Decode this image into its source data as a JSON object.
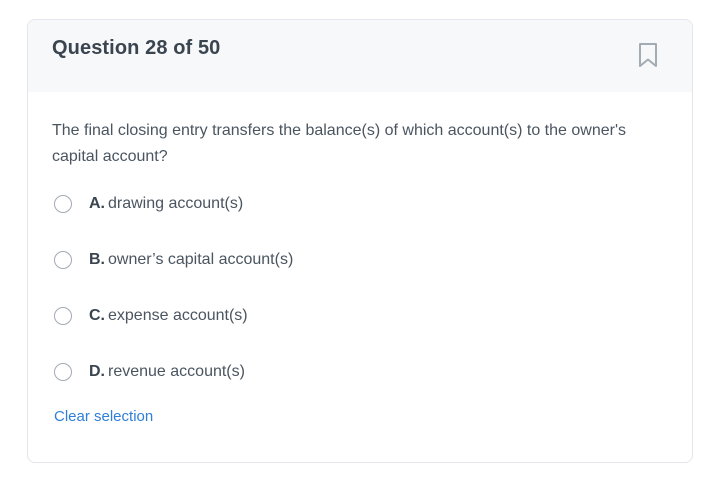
{
  "question": {
    "title": "Question 28 of 50",
    "text": "The final closing entry transfers the balance(s) of which account(s) to the owner's capital account?",
    "bookmark_icon": "bookmark-icon"
  },
  "options": [
    {
      "letter": "A.",
      "text": "drawing account(s)"
    },
    {
      "letter": "B.",
      "text": "owner’s capital account(s)"
    },
    {
      "letter": "C.",
      "text": "expense account(s)"
    },
    {
      "letter": "D.",
      "text": "revenue account(s)"
    }
  ],
  "actions": {
    "clear_label": "Clear selection"
  },
  "colors": {
    "link": "#2f7fd6",
    "header_bg": "#f7f8f9",
    "text": "#4a5560"
  }
}
